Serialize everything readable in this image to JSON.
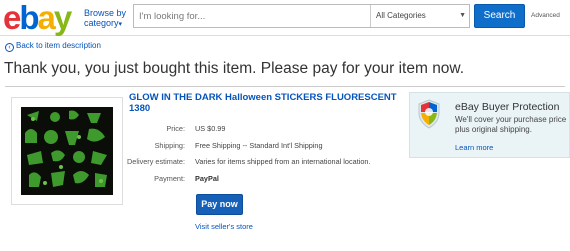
{
  "header": {
    "logo_letters": [
      "e",
      "b",
      "a",
      "y"
    ],
    "browse_label_line1": "Browse by",
    "browse_label_line2": "category",
    "search_placeholder": "I'm looking for...",
    "category_selected": "All Categories",
    "search_button": "Search",
    "advanced_link": "Advanced"
  },
  "back_link": "Back to item description",
  "page_title": "Thank you, you just bought this item. Please pay for your item now.",
  "item": {
    "title": "GLOW IN THE DARK Halloween STICKERS FLUORESCENT 1380",
    "price_label": "Price:",
    "price_value": "US $0.99",
    "shipping_label": "Shipping:",
    "shipping_value": "Free Shipping -- Standard Int'l Shipping",
    "delivery_label": "Delivery estimate:",
    "delivery_value": "Varies for items shipped from an international location.",
    "payment_label": "Payment:",
    "payment_value": "PayPal",
    "pay_button": "Pay now",
    "visit_store_link": "Visit seller's store"
  },
  "buyer_protection": {
    "title": "eBay Buyer Protection",
    "text": "We'll cover your purchase price plus original shipping.",
    "link": "Learn more"
  },
  "colors": {
    "link": "#0654ba",
    "search_button": "#0f6ec9",
    "pay_button": "#1660b7",
    "protection_bg": "#eaf4f6"
  }
}
